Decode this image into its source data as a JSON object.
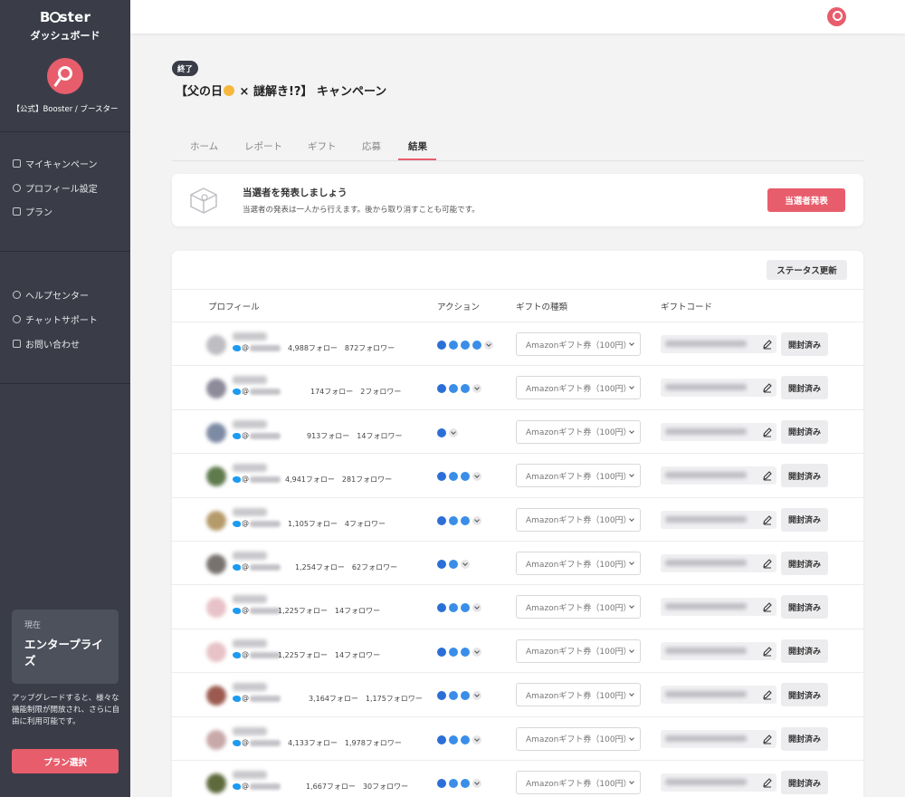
{
  "sidebar": {
    "brand": "Booster",
    "brand_parts": [
      "B",
      "ster"
    ],
    "dashboard": "ダッシュボード",
    "account_name": "【公式】Booster / ブースター",
    "nav_main": [
      {
        "label": "マイキャンペーン",
        "icon": "campaign-icon"
      },
      {
        "label": "プロフィール設定",
        "icon": "profile-icon"
      },
      {
        "label": "プラン",
        "icon": "plan-icon"
      }
    ],
    "nav_support": [
      {
        "label": "ヘルプセンター",
        "icon": "help-icon"
      },
      {
        "label": "チャットサポート",
        "icon": "chat-icon"
      },
      {
        "label": "お問い合わせ",
        "icon": "send-icon"
      }
    ],
    "plan": {
      "now_label": "現在",
      "name": "エンタープライズ"
    },
    "upgrade_note": "アップグレードすると、様々な機能制限が開放され、さらに自由に利用可能です。",
    "plan_button": "プラン選択"
  },
  "campaign": {
    "status": "終了",
    "title_before": "【父の日",
    "title_after": "× 謎解き!?】 キャンペーン"
  },
  "tabs": [
    {
      "label": "ホーム"
    },
    {
      "label": "レポート"
    },
    {
      "label": "ギフト"
    },
    {
      "label": "応募"
    },
    {
      "label": "結果"
    }
  ],
  "active_tab": 4,
  "winner_card": {
    "title": "当選者を発表しましょう",
    "description": "当選者の発表は一人から行えます。後から取り消すことも可能です。",
    "button": "当選者発表"
  },
  "table": {
    "status_update_button": "ステータス更新",
    "columns": [
      "プロフィール",
      "アクション",
      "ギフトの種類",
      "ギフトコード"
    ],
    "at_symbol": "@",
    "gift_option": "Amazonギフト券（100円）",
    "opened_label": "開封済み",
    "rows": [
      {
        "follow": "4,988フォロー　872フォロワー",
        "actions": 4,
        "avatar": "#bdbdc2"
      },
      {
        "follow": "174フォロー　2フォロワー",
        "actions": 3,
        "avatar": "#8d8a9a"
      },
      {
        "follow": "913フォロー　14フォロワー",
        "actions": 1,
        "avatar": "#7c8aa3"
      },
      {
        "follow": "4,941フォロー　281フォロワー",
        "actions": 3,
        "avatar": "#5f7a4c"
      },
      {
        "follow": "1,105フォロー　4フォロワー",
        "actions": 3,
        "avatar": "#b59a6a"
      },
      {
        "follow": "1,254フォロー　62フォロワー",
        "actions": 2,
        "avatar": "#77726d"
      },
      {
        "follow": "1,225フォロー　14フォロワー",
        "actions": 3,
        "avatar": "#e7c2c6"
      },
      {
        "follow": "1,225フォロー　14フォロワー",
        "actions": 3,
        "avatar": "#e7c2c6"
      },
      {
        "follow": "3,164フォロー　1,175フォロワー",
        "actions": 3,
        "avatar": "#9c5a4f"
      },
      {
        "follow": "4,133フォロー　1,978フォロワー",
        "actions": 3,
        "avatar": "#c8a9a9"
      },
      {
        "follow": "1,667フォロー　30フォロワー",
        "actions": 3,
        "avatar": "#5e6a3c"
      }
    ]
  },
  "colors": {
    "accent": "#e85d6c",
    "sidebar": "#3a3d48",
    "action": "#2b6fd6",
    "twitter": "#1d9bf0"
  }
}
